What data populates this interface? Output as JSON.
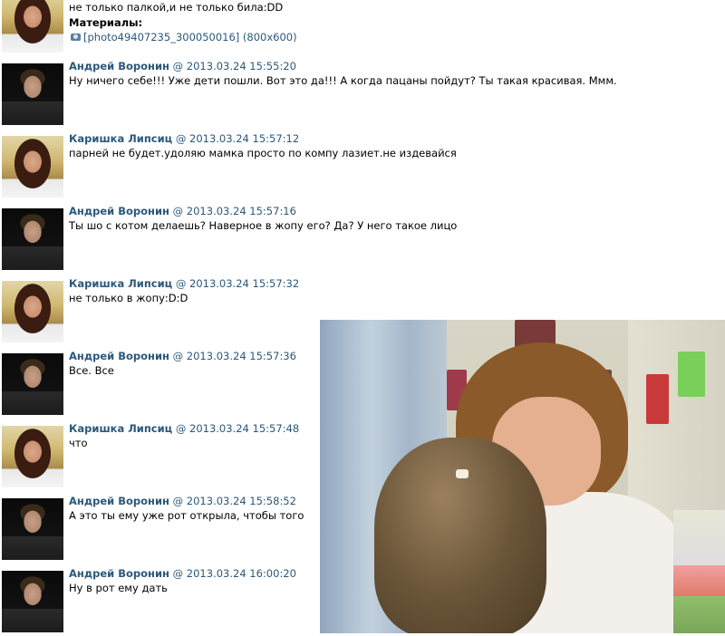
{
  "messages": [
    {
      "author": "",
      "at": "",
      "date": "",
      "text": "не только палкой,и не только била:DD",
      "avatar": "girl"
    },
    {
      "author": "Андрей Воронин",
      "at": "@",
      "date": "2013.03.24 15:55:20",
      "text": "Ну ничего себе!!! Уже дети пошли. Вот это да!!! А когда пацаны пойдут? Ты такая красивая. Ммм.",
      "avatar": "boy"
    },
    {
      "author": "Каришка Липсиц",
      "at": "@",
      "date": "2013.03.24 15:57:12",
      "text": "парней не будет.удоляю мамка просто по компу лазиет.не издевайся",
      "avatar": "girl"
    },
    {
      "author": "Андрей Воронин",
      "at": "@",
      "date": "2013.03.24 15:57:16",
      "text": "Ты шо с котом делаешь? Наверное в жопу его? Да? У него такое лицо",
      "avatar": "boy"
    },
    {
      "author": "Каришка Липсиц",
      "at": "@",
      "date": "2013.03.24 15:57:32",
      "text": "не только в жопу:D:D",
      "avatar": "girl"
    },
    {
      "author": "Андрей Воронин",
      "at": "@",
      "date": "2013.03.24 15:57:36",
      "text": "Все. Все",
      "avatar": "boy"
    },
    {
      "author": "Каришка Липсиц",
      "at": "@",
      "date": "2013.03.24 15:57:48",
      "text": "что",
      "avatar": "girl"
    },
    {
      "author": "Андрей Воронин",
      "at": "@",
      "date": "2013.03.24 15:58:52",
      "text": "А это ты ему уже рот открыла, чтобы того",
      "avatar": "boy"
    },
    {
      "author": "Андрей Воронин",
      "at": "@",
      "date": "2013.03.24 16:00:20",
      "text": "Ну в рот ему дать",
      "avatar": "boy"
    }
  ],
  "first_message_extra": {
    "materials_label": "Материалы:",
    "attachment_icon": "camera-icon",
    "attachment_text": "[photo49407235_300050016] (800x600)"
  },
  "colors": {
    "link": "#2b587a",
    "text": "#000000",
    "background": "#ffffff"
  }
}
